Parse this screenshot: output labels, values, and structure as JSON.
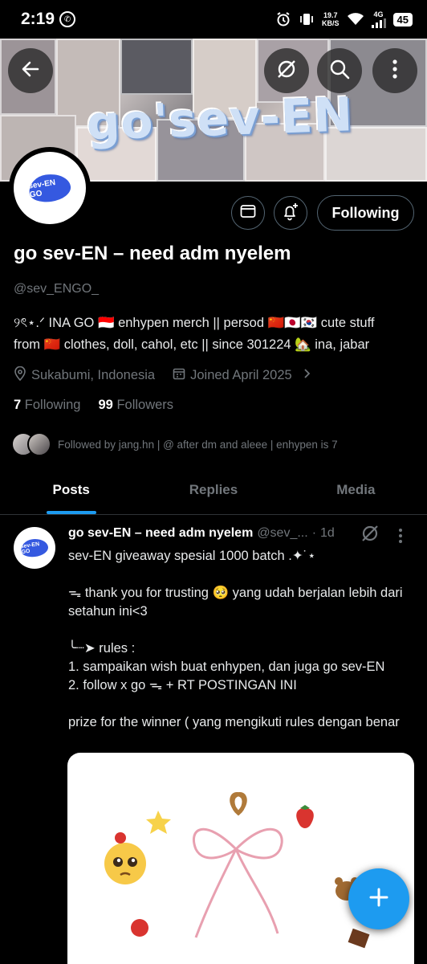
{
  "status_bar": {
    "time": "2:19",
    "net_speed_value": "19.7",
    "net_speed_unit": "KB/S",
    "network": "4G",
    "battery": "45"
  },
  "banner": {
    "title": "go'sev-EN"
  },
  "avatar": {
    "logo_text": "sev-EN GO"
  },
  "actions": {
    "following_label": "Following"
  },
  "profile": {
    "display_name": "go sev-EN – need adm nyelem",
    "handle": "@sev_ENGO_",
    "bio_line1": "୨ৎ⋆.ᐟ INA GO 🇮🇩 enhypen merch || persod 🇨🇳🇯🇵🇰🇷  cute stuff",
    "bio_line2": "from 🇨🇳 clothes, doll, cahol, etc || since 301224 🏡 ina, jabar",
    "location": "Sukabumi, Indonesia",
    "joined": "Joined April 2025",
    "following_count": "7",
    "following_label": "Following",
    "followers_count": "99",
    "followers_label": "Followers",
    "followed_by": "Followed by jang.hn | @ after dm and aleee | enhypen is 7"
  },
  "tabs": [
    {
      "label": "Posts"
    },
    {
      "label": "Replies"
    },
    {
      "label": "Media"
    }
  ],
  "post": {
    "author_name": "go sev-EN – need adm nyelem",
    "author_handle": "@sev_...",
    "dot": "·",
    "time": "1d",
    "text": "sev-EN giveaway spesial 1000 batch .✦˙⋆\n\nᯓ thank you for trusting 🥺 yang udah berjalan lebih dari setahun ini<3\n\n╰┈➤ rules :\n1. sampaikan wish buat enhypen, dan juga go sev-EN\n2. follow x go ᯓ + RT POSTINGAN INI\n\nprize for the winner ( yang mengikuti rules dengan benar"
  },
  "colors": {
    "accent": "#1d9bf0",
    "background": "#000000",
    "muted_text": "#71767b",
    "logo_blue": "#3559e0"
  }
}
